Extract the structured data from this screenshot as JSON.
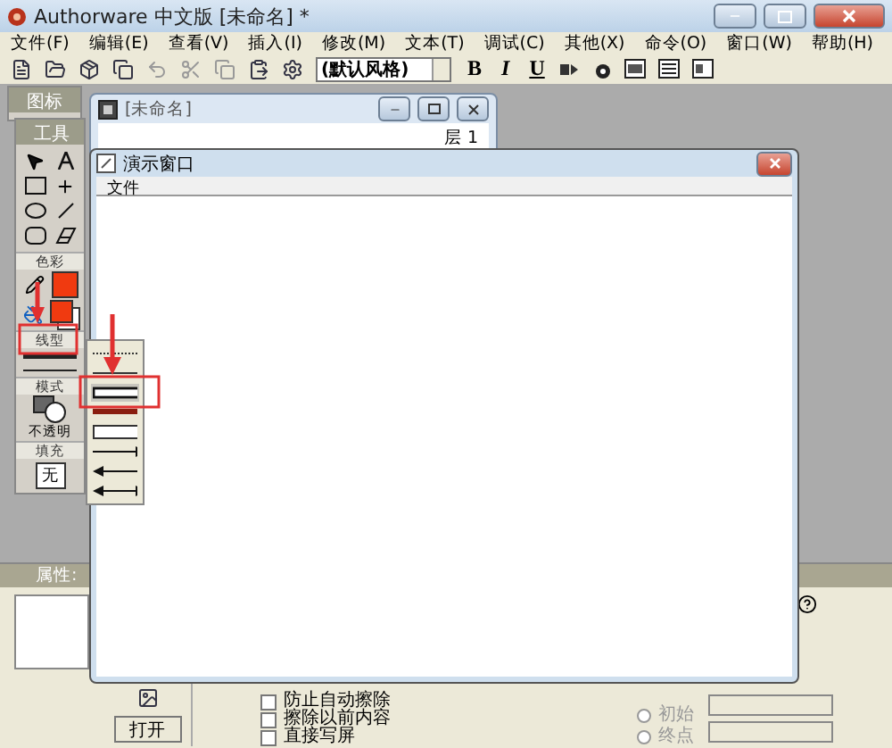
{
  "app_window": {
    "title": "Authorware 中文版 [未命名] *"
  },
  "menu": [
    "文件(F)",
    "编辑(E)",
    "查看(V)",
    "插入(I)",
    "修改(M)",
    "文本(T)",
    "调试(C)",
    "其他(X)",
    "命令(O)",
    "窗口(W)",
    "帮助(H)"
  ],
  "toolbar": {
    "style_select": "(默认风格)",
    "format_buttons": [
      "B",
      "I",
      "U"
    ]
  },
  "icon_palette": {
    "title": "图标"
  },
  "toolbox": {
    "title": "工具",
    "color_label": "色彩",
    "line_label": "线型",
    "mode_label": "模式",
    "mode_value": "不透明",
    "fill_label": "填充",
    "fill_value": "无"
  },
  "line_styles": [
    {
      "kind": "dotted",
      "selected": false
    },
    {
      "kind": "thin",
      "selected": false
    },
    {
      "kind": "double",
      "selected": true
    },
    {
      "kind": "thick",
      "selected": false
    },
    {
      "kind": "hollow",
      "selected": false
    },
    {
      "kind": "arrow-right",
      "selected": false
    },
    {
      "kind": "arrow-left",
      "selected": false
    },
    {
      "kind": "arrow-both",
      "selected": false
    }
  ],
  "design_window": {
    "title": "[未命名]",
    "layer_label": "层 1"
  },
  "presentation_window": {
    "title": "演示窗口",
    "menu": [
      "文件"
    ]
  },
  "properties": {
    "title": "属性:",
    "open_button": "打开",
    "checkboxes": [
      {
        "label": "防止自动擦除",
        "checked": false
      },
      {
        "label": "擦除以前内容",
        "checked": false
      },
      {
        "label": "直接写屏",
        "checked": false
      }
    ],
    "radios": [
      {
        "label": "初始",
        "selected": false
      },
      {
        "label": "终点",
        "selected": false
      }
    ]
  }
}
